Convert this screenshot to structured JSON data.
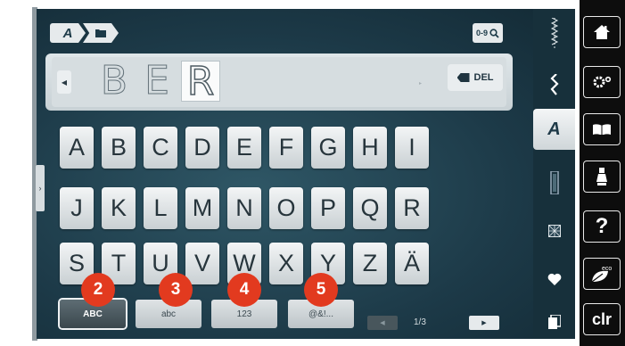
{
  "breadcrumb": {
    "font_label": "A"
  },
  "search": {
    "label": "0-9"
  },
  "text_field": {
    "letters": [
      "B",
      "E",
      "R"
    ],
    "del_label": "DEL"
  },
  "keyboard": {
    "row1": [
      "A",
      "B",
      "C",
      "D",
      "E",
      "F",
      "G",
      "H",
      "I"
    ],
    "row2": [
      "J",
      "K",
      "L",
      "M",
      "N",
      "O",
      "P",
      "Q",
      "R"
    ],
    "row3": [
      "S",
      "T",
      "U",
      "V",
      "W",
      "X",
      "Y",
      "Z",
      "Ä"
    ]
  },
  "modes": [
    "ABC",
    "abc",
    "123",
    "@&!..."
  ],
  "badges": [
    "2",
    "3",
    "4",
    "5"
  ],
  "pagination": {
    "indicator": "1/3"
  },
  "side_panel": {
    "items": [
      "straight-stitch-icon",
      "zigzag-icon",
      "alphabet-icon",
      "buttonhole-icon",
      "quilt-icon",
      "favorite-icon",
      "personal-memory-icon"
    ],
    "active_label": "A"
  },
  "function_column": {
    "items": [
      "home-icon",
      "setup-icon",
      "tutorial-icon",
      "presser-foot-icon",
      "help-icon",
      "eco-icon",
      "clear-icon"
    ],
    "help_label": "?",
    "eco_label": "eco",
    "clr_label": "clr"
  },
  "colors": {
    "badge": "#e23a1f",
    "screen_bg": "#1c3947",
    "active_mode": "#3a474d"
  }
}
